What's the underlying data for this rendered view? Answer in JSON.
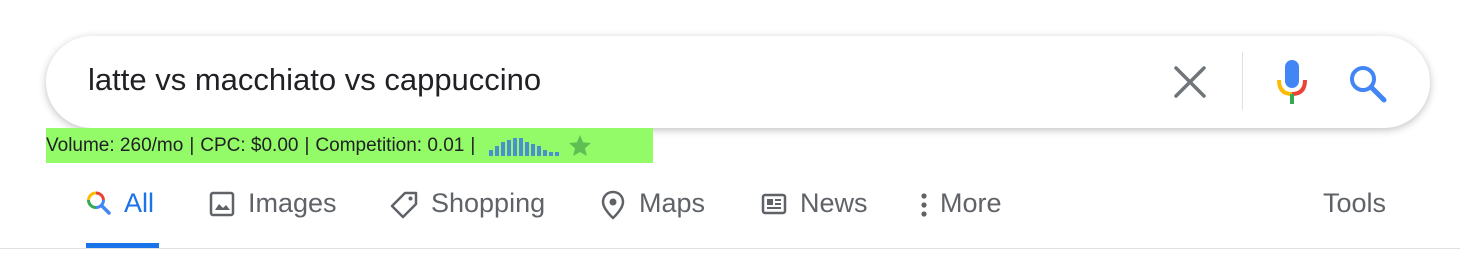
{
  "search": {
    "query": "latte vs macchiato vs cappuccino",
    "clear_icon": "close-icon",
    "mic_icon": "microphone-icon",
    "search_icon": "search-icon"
  },
  "keyword_bar": {
    "volume": "Volume: 260/mo",
    "cpc": "CPC: $0.00",
    "competition": "Competition: 0.01",
    "separator": "|",
    "background_color": "#93fb67",
    "trend_values": [
      3,
      5,
      7,
      8,
      9,
      9,
      7,
      6,
      5,
      3,
      2,
      2
    ]
  },
  "tabs": [
    {
      "label": "All",
      "icon": "search-icon",
      "active": true
    },
    {
      "label": "Images",
      "icon": "image-icon",
      "active": false
    },
    {
      "label": "Shopping",
      "icon": "tag-icon",
      "active": false
    },
    {
      "label": "Maps",
      "icon": "map-pin-icon",
      "active": false
    },
    {
      "label": "News",
      "icon": "newspaper-icon",
      "active": false
    },
    {
      "label": "More",
      "icon": "more-vertical-icon",
      "active": false
    }
  ],
  "tools_label": "Tools",
  "colors": {
    "accent": "#1a73e8",
    "tab_text": "#5f6368",
    "query_text": "#202124"
  }
}
